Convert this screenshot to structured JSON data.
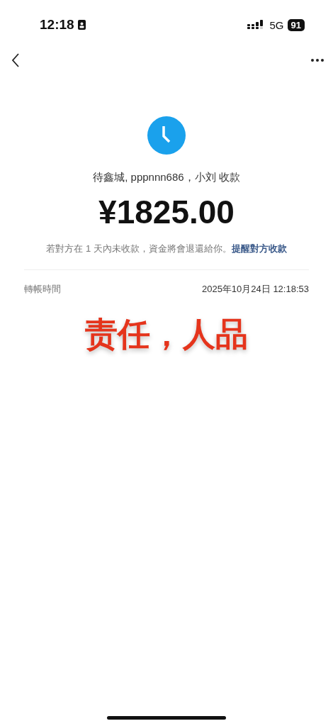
{
  "status_bar": {
    "time": "12:18",
    "network": "5G",
    "battery": "91"
  },
  "payee": "待鑫城, pppnnn686，小刘 收款",
  "amount": "¥1825.00",
  "notice": {
    "text": "若對方在 1 天內未收款，資金將會退還給你。",
    "link": "提醒對方收款"
  },
  "details": [
    {
      "label": "轉帳時間",
      "value": "2025年10月24日 12:18:53"
    }
  ],
  "overlay_caption": "责任，人品"
}
